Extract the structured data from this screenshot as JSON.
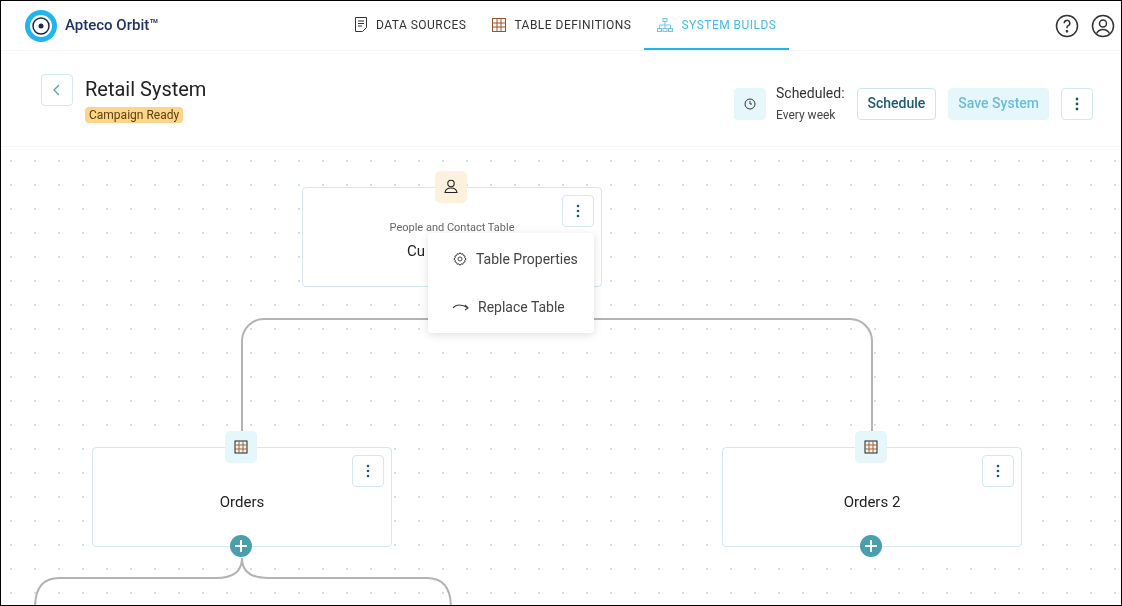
{
  "app": {
    "name": "Apteco Orbit™"
  },
  "nav": [
    {
      "label": "DATA SOURCES",
      "selected": false
    },
    {
      "label": "TABLE DEFINITIONS",
      "selected": false
    },
    {
      "label": "SYSTEM BUILDS",
      "selected": true
    }
  ],
  "header": {
    "title": "Retail System",
    "badge": "Campaign Ready",
    "schedule_label": "Scheduled:",
    "schedule_value": "Every week",
    "buttons": [
      {
        "label": "Schedule",
        "disabled": false
      },
      {
        "label": "Save System",
        "disabled": true
      }
    ]
  },
  "nodes": [
    {
      "kind": "people",
      "subtitle": "People and Contact Table",
      "title": "Cu",
      "add_button": false
    },
    {
      "kind": "table",
      "title": "Orders",
      "add_button": true
    },
    {
      "kind": "table",
      "title": "Orders 2",
      "add_button": true
    }
  ],
  "context_menu": {
    "items": [
      "Table Properties",
      "Replace Table"
    ]
  }
}
